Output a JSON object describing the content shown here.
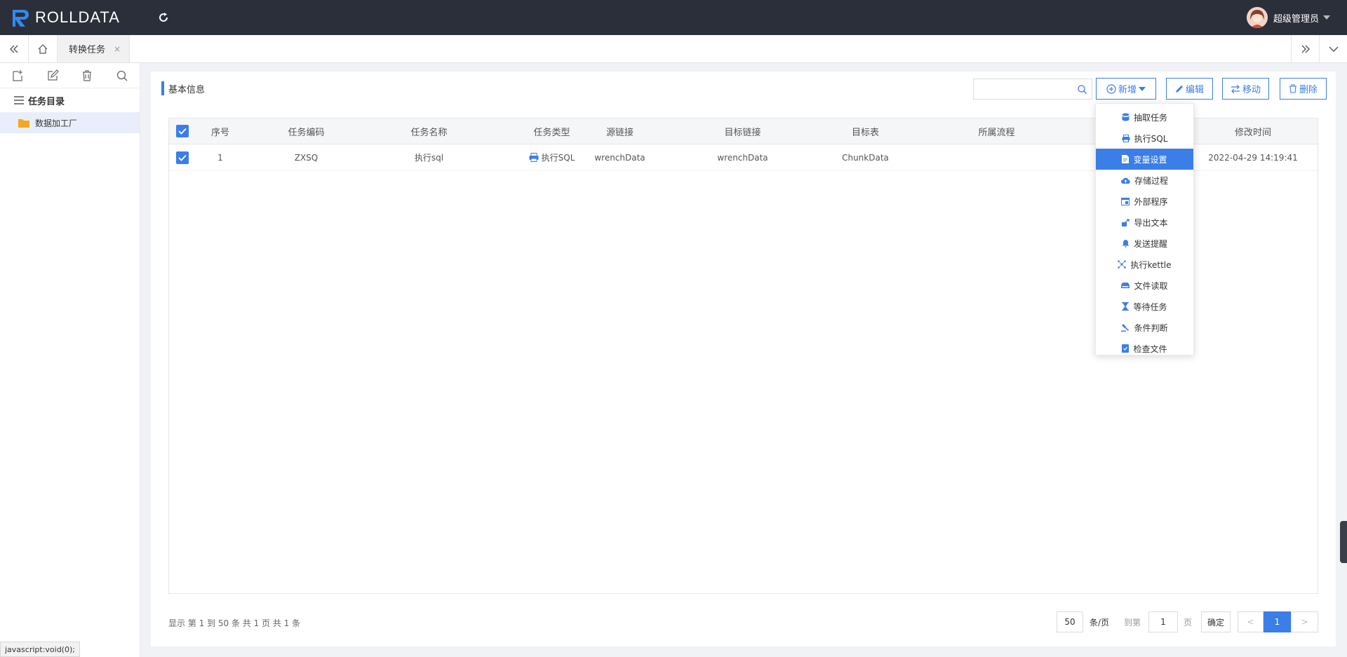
{
  "app": {
    "brand": "ROLLDATA",
    "user_name": "超级管理员"
  },
  "tabs": [
    {
      "label": "转换任务",
      "close": "×"
    }
  ],
  "sidebar": {
    "tree_title": "任务目录",
    "nodes": [
      {
        "label": "数据加工厂"
      }
    ]
  },
  "main": {
    "section_title": "基本信息",
    "search_placeholder": "",
    "buttons": {
      "add": "新增",
      "edit": "编辑",
      "move": "移动",
      "delete": "删除"
    },
    "dropdown": {
      "items": [
        {
          "label": "抽取任务",
          "icon": "database-icon"
        },
        {
          "label": "执行SQL",
          "icon": "printer-icon"
        },
        {
          "label": "变量设置",
          "icon": "document-icon",
          "active": true
        },
        {
          "label": "存储过程",
          "icon": "cloud-upload-icon"
        },
        {
          "label": "外部程序",
          "icon": "window-icon"
        },
        {
          "label": "导出文本",
          "icon": "export-icon"
        },
        {
          "label": "发送提醒",
          "icon": "bell-icon"
        },
        {
          "label": "执行kettle",
          "icon": "network-icon"
        },
        {
          "label": "文件读取",
          "icon": "drive-icon"
        },
        {
          "label": "等待任务",
          "icon": "hourglass-icon"
        },
        {
          "label": "条件判断",
          "icon": "gavel-icon"
        },
        {
          "label": "检查文件",
          "icon": "file-check-icon"
        }
      ]
    },
    "table": {
      "columns": [
        "序号",
        "任务编码",
        "任务名称",
        "任务类型",
        "源链接",
        "目标链接",
        "目标表",
        "所属流程",
        "修改时间"
      ],
      "rows": [
        {
          "index": "1",
          "code": "ZXSQ",
          "name": "执行sql",
          "type": "执行SQL",
          "source": "wrenchData",
          "target": "wrenchData",
          "target_table": "ChunkData",
          "process": "",
          "modified": "2022-04-29 14:19:41"
        }
      ]
    },
    "pagination": {
      "info": "显示 第 1 到 50 条 共 1 页 共 1 条",
      "page_size": "50",
      "page_size_label": "条/页",
      "goto_label": "到第",
      "goto_value": "1",
      "page_label": "页",
      "confirm": "确定",
      "prev": "<",
      "current": "1",
      "next": ">"
    }
  },
  "statusbar": {
    "text": "javascript:void(0);"
  },
  "colors": {
    "accent": "#3b7ee8",
    "header_bg": "#2b2f3a"
  }
}
